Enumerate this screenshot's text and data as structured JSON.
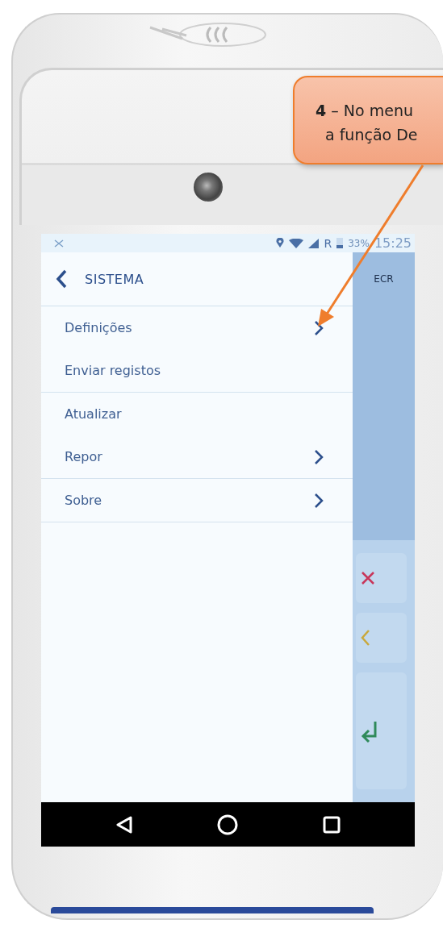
{
  "callout": {
    "lines": [
      "**4** – No menu",
      "a função De"
    ]
  },
  "status_bar": {
    "network_letter": "R",
    "battery": "33%",
    "time": "15:25"
  },
  "drawer": {
    "title": "SISTEMA",
    "groups": [
      [
        {
          "label": "Definições",
          "has_arrow": true
        },
        {
          "label": "Enviar registos",
          "has_arrow": false
        }
      ],
      [
        {
          "label": "Atualizar",
          "has_arrow": false
        },
        {
          "label": "Repor",
          "has_arrow": true
        }
      ],
      [
        {
          "label": "Sobre",
          "has_arrow": true
        }
      ]
    ]
  },
  "side_panel": {
    "title": "ECR",
    "keys": [
      {
        "kind": "cancel"
      },
      {
        "kind": "back"
      },
      {
        "kind": "enter"
      }
    ]
  }
}
